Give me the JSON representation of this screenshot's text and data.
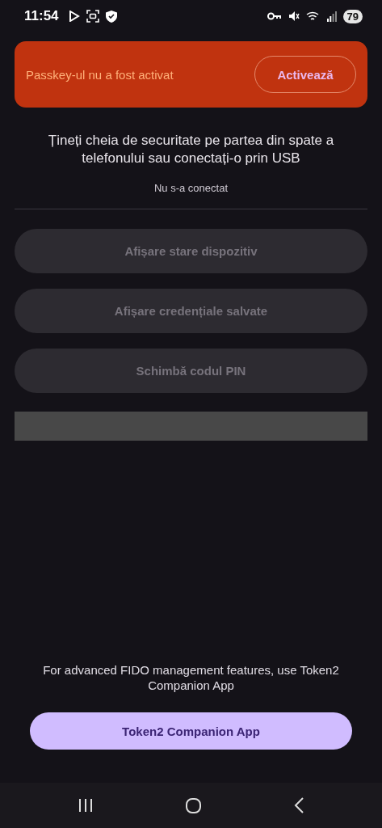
{
  "status_bar": {
    "time": "11:54",
    "battery": "79"
  },
  "banner": {
    "message": "Passkey-ul nu a fost activat",
    "action": "Activează"
  },
  "instruction": "Țineți cheia de securitate pe partea din spate a telefonului sau conectați-o prin USB",
  "connection_status": "Nu s-a conectat",
  "actions": [
    {
      "label": "Afișare stare dispozitiv",
      "disabled": true
    },
    {
      "label": "Afișare credențiale salvate",
      "disabled": true
    },
    {
      "label": "Schimbă codul PIN",
      "disabled": true
    }
  ],
  "footer": {
    "note": "For advanced FIDO management features, use Token2 Companion App",
    "button": "Token2 Companion App"
  }
}
